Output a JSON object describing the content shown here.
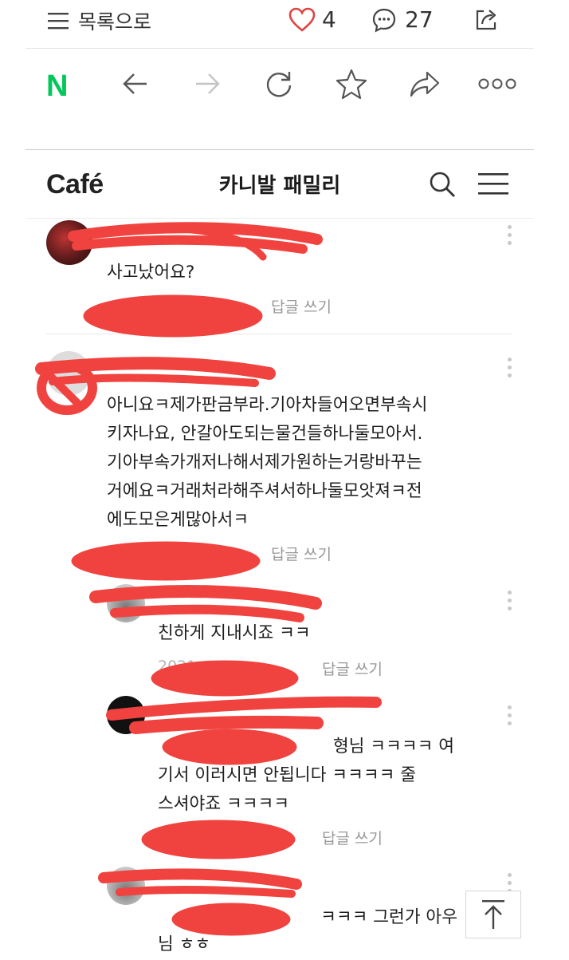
{
  "topbar": {
    "back_label": "목록으로",
    "like_count": "4",
    "comment_count": "27"
  },
  "browser": {
    "logo": "N"
  },
  "cafe": {
    "logo": "Café",
    "title": "카니발 패밀리"
  },
  "comments": [
    {
      "lines": [
        "사고났어요?"
      ],
      "reply_label": "답글 쓰기"
    },
    {
      "lines": [
        "아니요ㅋ제가판금부라.기아차들어오면부속시",
        "키자나요, 안갈아도되는물건들하나둘모아서.",
        "기아부속가개저나해서제가원하는거랑바꾸는",
        "거에요ㅋ거래처라해주셔서하나둘모앗져ㅋ전",
        "에도모은게많아서ㅋ"
      ],
      "reply_label": "답글 쓰기"
    },
    {
      "lines": [
        "친하게 지내시죠 ㅋㅋ"
      ],
      "date": "2021.",
      "reply_label": "답글 쓰기"
    },
    {
      "lines": [
        "형님 ㅋㅋㅋㅋ 여",
        "기서 이러시면 안됩니다 ㅋㅋㅋㅋ 줄",
        "스셔야죠 ㅋㅋㅋㅋ"
      ],
      "date": "202",
      "reply_label": "답글 쓰기"
    },
    {
      "lines": [
        "ㅋㅋㅋ 그런가 아우",
        "님 ㅎㅎ"
      ]
    }
  ],
  "colors": {
    "naver_green": "#03c75a",
    "like_heart": "#e0443e",
    "redaction": "#f0433f",
    "reply_text": "#999999"
  }
}
